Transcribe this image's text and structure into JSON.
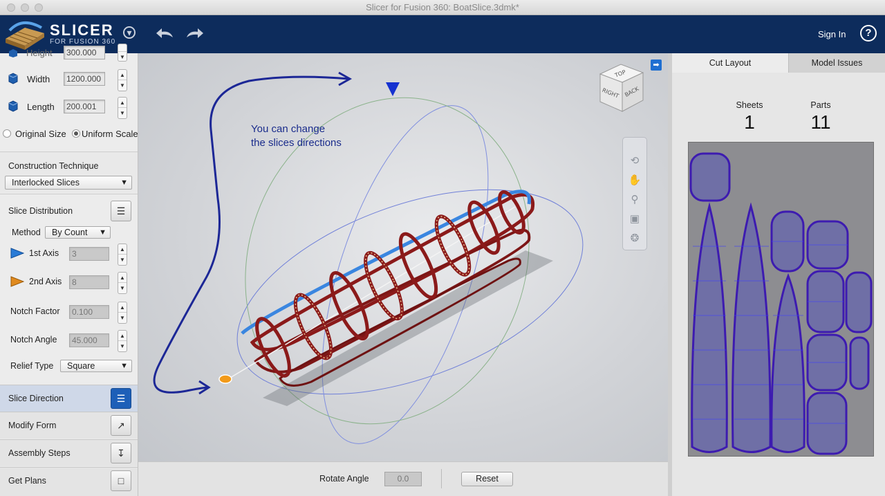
{
  "window": {
    "title": "Slicer for Fusion 360: BoatSlice.3dmk*"
  },
  "header": {
    "brand": "SLICER",
    "brand_sub": "FOR FUSION 360",
    "sign_in": "Sign In",
    "help": "?"
  },
  "left_panel": {
    "height_label": "Height",
    "height_value": "300.000",
    "width_label": "Width",
    "width_value": "1200.000",
    "length_label": "Length",
    "length_value": "200.001",
    "original_size_label": "Original Size",
    "uniform_scale_label": "Uniform Scale",
    "construction_label": "Construction Technique",
    "construction_value": "Interlocked Slices",
    "distribution_label": "Slice Distribution",
    "method_label": "Method",
    "method_value": "By Count",
    "axis1_label": "1st Axis",
    "axis1_value": "3",
    "axis2_label": "2nd Axis",
    "axis2_value": "8",
    "notch_factor_label": "Notch Factor",
    "notch_factor_value": "0.100",
    "notch_angle_label": "Notch Angle",
    "notch_angle_value": "45.000",
    "relief_label": "Relief Type",
    "relief_value": "Square",
    "nav": {
      "slice_direction": "Slice Direction",
      "modify_form": "Modify Form",
      "assembly_steps": "Assembly Steps",
      "get_plans": "Get Plans"
    }
  },
  "viewport": {
    "annotation_line1": "You can change",
    "annotation_line2": "the slices directions",
    "cube_top": "TOP",
    "cube_right": "RIGHT",
    "cube_back": "BACK"
  },
  "bottom_bar": {
    "rotate_label": "Rotate Angle",
    "rotate_value": "0.0",
    "reset": "Reset"
  },
  "right_panel": {
    "tabs": [
      "Cut Layout",
      "Model Issues"
    ],
    "sheets_label": "Sheets",
    "sheets_value": "1",
    "parts_label": "Parts",
    "parts_value": "11"
  },
  "colors": {
    "header_bg": "#0d2c5c",
    "accent_blue": "#1d5fb8",
    "slice_red": "#8b1a1a",
    "annotation_blue": "#1a2c8c"
  }
}
